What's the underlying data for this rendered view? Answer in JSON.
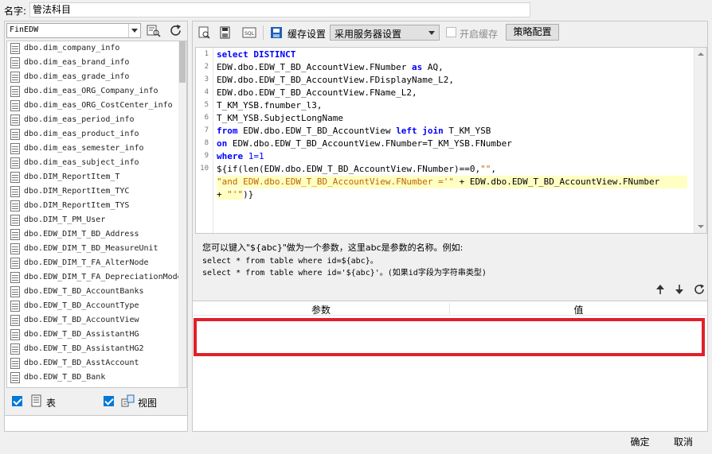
{
  "name_field": {
    "label": "名字:",
    "value": "管法科目"
  },
  "left": {
    "datasource": "FinEDW",
    "tables": [
      "dbo.dim_company_info",
      "dbo.dim_eas_brand_info",
      "dbo.dim_eas_grade_info",
      "dbo.dim_eas_ORG_Company_info",
      "dbo.dim_eas_ORG_CostCenter_info",
      "dbo.dim_eas_period_info",
      "dbo.dim_eas_product_info",
      "dbo.dim_eas_semester_info",
      "dbo.dim_eas_subject_info",
      "dbo.DIM_ReportItem_T",
      "dbo.DIM_ReportItem_TYC",
      "dbo.DIM_ReportItem_TYS",
      "dbo.DIM_T_PM_User",
      "dbo.EDW_DIM_T_BD_Address",
      "dbo.EDW_DIM_T_BD_MeasureUnit",
      "dbo.EDW_DIM_T_FA_AlterNode",
      "dbo.EDW_DIM_T_FA_DepreciationMode",
      "dbo.EDW_T_BD_AccountBanks",
      "dbo.EDW_T_BD_AccountType",
      "dbo.EDW_T_BD_AccountView",
      "dbo.EDW_T_BD_AssistantHG",
      "dbo.EDW_T_BD_AssistantHG2",
      "dbo.EDW_T_BD_AsstAccount",
      "dbo.EDW_T_BD_Bank"
    ],
    "table_checkbox_label": "表",
    "view_checkbox_label": "视图"
  },
  "toolbar": {
    "cache_label": "缓存设置",
    "cache_mode": "采用服务器设置",
    "enable_cache_label": "开启缓存",
    "strategy_button": "策略配置",
    "sql_icon_text": "SQL"
  },
  "editor": {
    "line_numbers": [
      "1",
      "2",
      "3",
      "4",
      "5",
      "6",
      "7",
      "8",
      "9",
      "10"
    ]
  },
  "hint": {
    "line1": "您可以键入\"${abc}\"做为一个参数，这里abc是参数的名称。例如:",
    "line2": "select * from table where id=${abc}。",
    "line3": "select * from table where id='${abc}'。(如果id字段为字符串类型)"
  },
  "params_table": {
    "col_param": "参数",
    "col_value": "值"
  },
  "footer": {
    "ok": "确定",
    "cancel": "取消"
  },
  "colors": {
    "highlight_box": "#e0202a",
    "keyword": "#0000ff",
    "string": "#c06400"
  }
}
